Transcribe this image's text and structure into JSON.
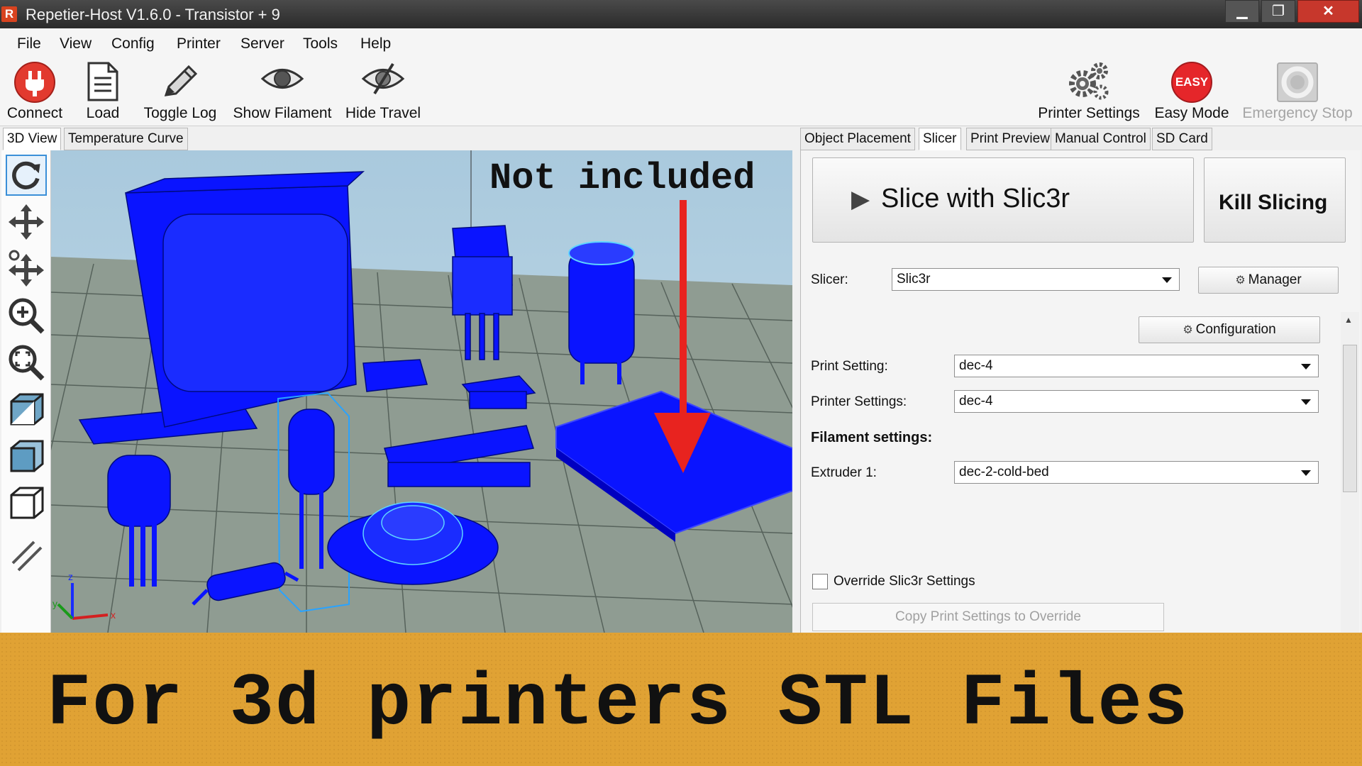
{
  "window": {
    "title": "Repetier-Host V1.6.0 - Transistor + 9",
    "app_icon": "R",
    "min_glyph": "▁",
    "max_glyph": "❐",
    "close_glyph": "✕"
  },
  "menu": [
    "File",
    "View",
    "Config",
    "Printer",
    "Server",
    "Tools",
    "Help"
  ],
  "toolbar": {
    "connect": "Connect",
    "load": "Load",
    "toggle_log": "Toggle Log",
    "show_filament": "Show Filament",
    "hide_travel": "Hide Travel",
    "printer_settings": "Printer Settings",
    "easy_mode": "Easy Mode",
    "easy_badge": "EASY",
    "emergency_stop": "Emergency Stop"
  },
  "left_tabs": [
    "3D View",
    "Temperature Curve"
  ],
  "left_tools": [
    "rotate-icon",
    "move-icon",
    "pan-icon",
    "zoom-icon",
    "fit-icon",
    "iso-view-icon",
    "front-view-icon",
    "top-view-icon",
    "parallel-icon"
  ],
  "viewport": {
    "axis_labels": {
      "x": "x",
      "y": "y",
      "z": "z"
    },
    "model_color": "#0a14ff",
    "arrow_color": "#e8231f"
  },
  "right_tabs": [
    "Object Placement",
    "Slicer",
    "Print Preview",
    "Manual Control",
    "SD Card"
  ],
  "slicer": {
    "slice_button": "Slice with Slic3r",
    "kill_button": "Kill Slicing",
    "slicer_label": "Slicer:",
    "slicer_value": "Slic3r",
    "manager_button": "Manager",
    "configuration_button": "Configuration",
    "print_setting_label": "Print Setting:",
    "print_setting_value": "dec-4",
    "printer_settings_label": "Printer Settings:",
    "printer_settings_value": "dec-4",
    "filament_heading": "Filament settings:",
    "extruder_label": "Extruder 1:",
    "extruder_value": "dec-2-cold-bed",
    "override_label": "Override Slic3r Settings",
    "override_checked": false,
    "copy_button": "Copy Print Settings to Override"
  },
  "overlay": {
    "note": "Not included",
    "banner": "For 3d printers STL Files",
    "banner_color": "#e0a234"
  }
}
